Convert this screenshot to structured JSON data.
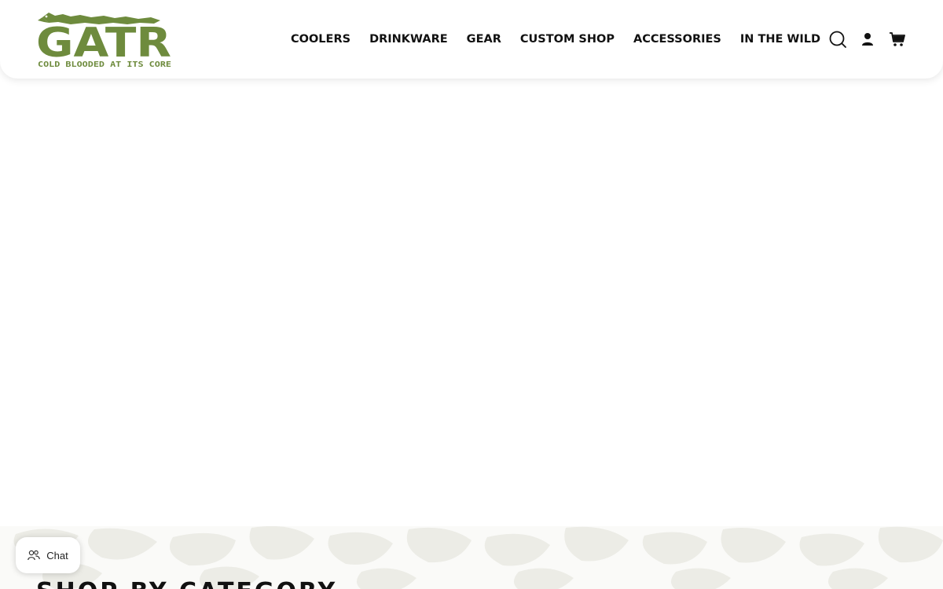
{
  "brand": {
    "name": "GATR",
    "tagline": "COLD BLOODED AT ITS CORE",
    "color": "#6e8b3d"
  },
  "nav": {
    "items": [
      {
        "label": "COOLERS"
      },
      {
        "label": "DRINKWARE"
      },
      {
        "label": "GEAR"
      },
      {
        "label": "CUSTOM SHOP"
      },
      {
        "label": "ACCESSORIES"
      },
      {
        "label": "IN THE WILD"
      }
    ]
  },
  "header_icons": {
    "search": "search-icon",
    "account": "account-icon",
    "cart": "cart-icon"
  },
  "category": {
    "title": "SHOP BY CATEGORY",
    "pattern_color": "#ecece6"
  },
  "chat": {
    "label": "Chat",
    "icon": "chat-people-icon"
  }
}
